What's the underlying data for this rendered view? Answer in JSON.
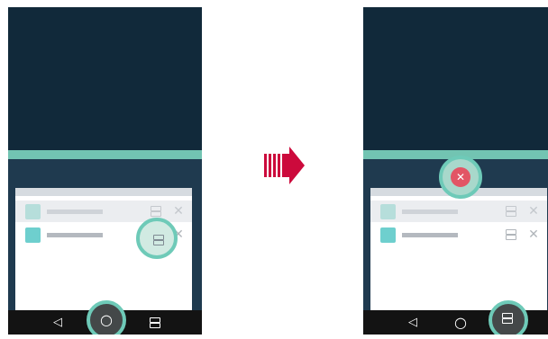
{
  "nav": {
    "back_glyph": "◁",
    "home_glyph": "○",
    "recent_icon": "recent-apps-icon"
  },
  "tile": {
    "close_glyph": "✕",
    "split_icon": "split-screen-icon"
  },
  "colors": {
    "top_app": "#11293a",
    "bottom_app": "#1f3a4f",
    "divider": "#72c4b2",
    "highlight_ring": "#6ecab8",
    "close_red": "#e25565",
    "arrow": "#cc0a3c",
    "navbar": "#131313"
  }
}
